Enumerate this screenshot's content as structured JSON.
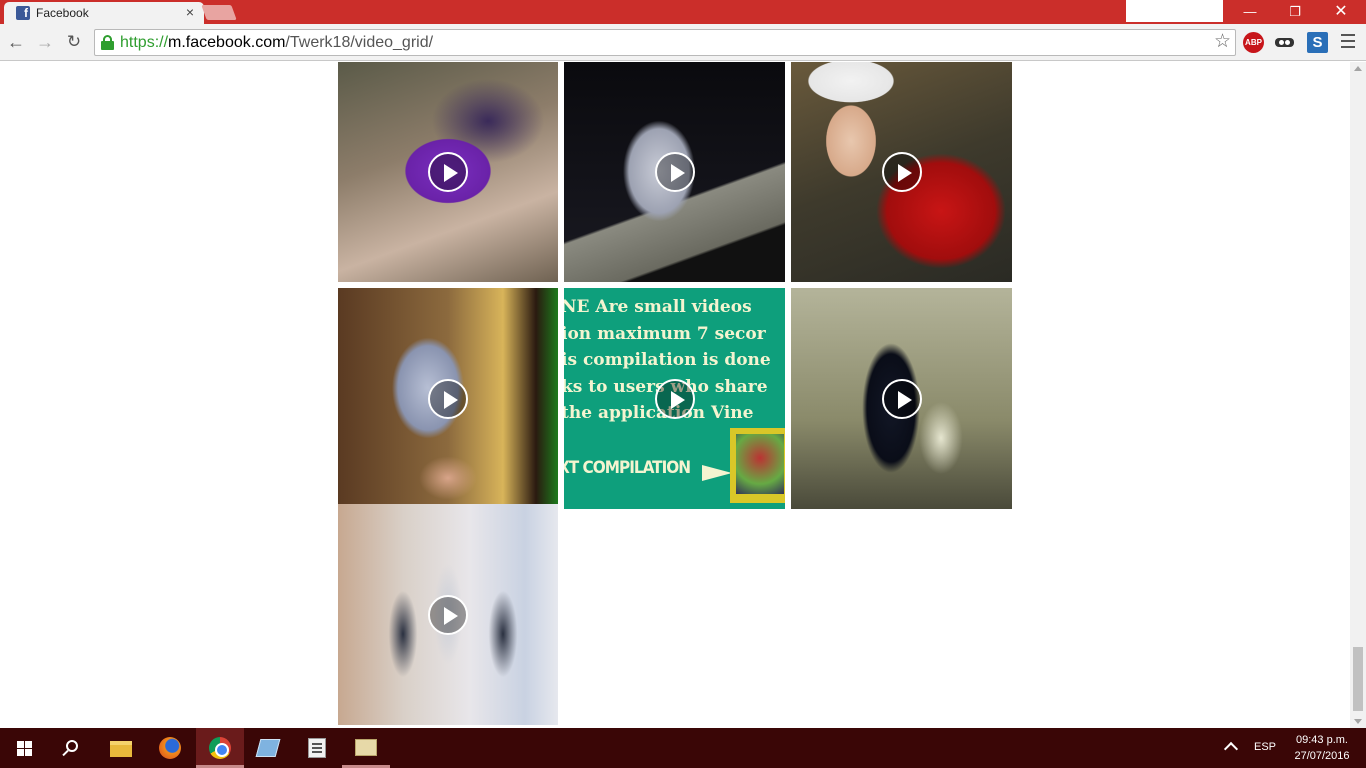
{
  "browser": {
    "tab": {
      "title": "Facebook",
      "close": "×"
    },
    "window_controls": {
      "minimize": "—",
      "maximize": "❐",
      "close": "✕"
    },
    "nav": {
      "back": "←",
      "forward": "→",
      "reload": "↻"
    },
    "omnibox": {
      "url_scheme": "https://",
      "url_host": "m.facebook.com",
      "url_path": "/Twerk18/video_grid/",
      "star": "☆"
    },
    "extensions": {
      "abp": "ABP",
      "sync": "S"
    }
  },
  "video_grid": {
    "videos": [
      {
        "id": "t1"
      },
      {
        "id": "t2"
      },
      {
        "id": "t3"
      },
      {
        "id": "t4"
      },
      {
        "id": "t5",
        "text_lines": [
          "NE Are small videos",
          "ion maximum 7 secor",
          "is compilation is done",
          "ks to users who share",
          " the application Vine"
        ],
        "banner": "XT COMPILATION"
      },
      {
        "id": "t6"
      },
      {
        "id": "t7"
      }
    ]
  },
  "taskbar": {
    "language": "ESP",
    "time": "09:43 p.m.",
    "date": "27/07/2016"
  }
}
